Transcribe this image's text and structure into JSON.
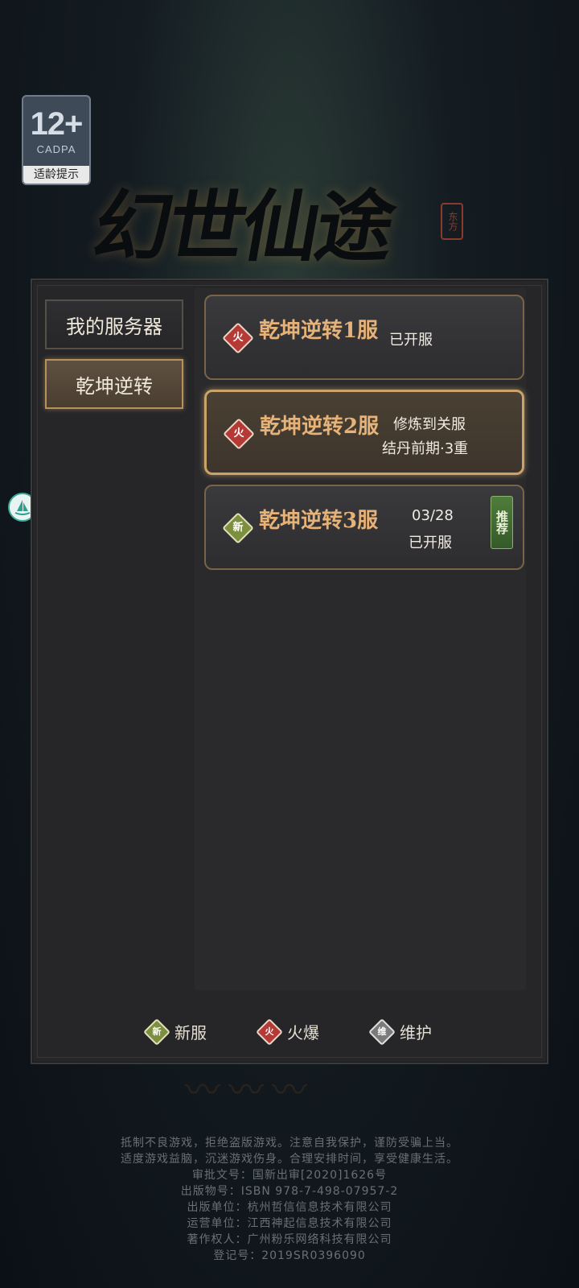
{
  "age_badge": {
    "age": "12+",
    "org": "CADPA",
    "tip": "适龄提示"
  },
  "logo": {
    "title": "幻世仙途",
    "seal": "东方"
  },
  "sidebar": {
    "tabs": [
      {
        "label": "我的服务器",
        "active": false
      },
      {
        "label": "乾坤逆转",
        "active": true
      }
    ]
  },
  "servers": [
    {
      "name": "乾坤逆转1服",
      "badge": "火",
      "badge_type": "hot",
      "status_line1": "已开服",
      "status_line2": "",
      "recommended": false,
      "selected": false
    },
    {
      "name": "乾坤逆转2服",
      "badge": "火",
      "badge_type": "hot",
      "status_line1": "修炼到关服",
      "status_line2": "结丹前期·3重",
      "recommended": false,
      "selected": true
    },
    {
      "name": "乾坤逆转3服",
      "badge": "新",
      "badge_type": "new",
      "status_line1": "03/28",
      "status_line2": "已开服",
      "recommended": true,
      "recommend_label": "推荐",
      "selected": false
    }
  ],
  "legend": [
    {
      "badge": "新",
      "label": "新服",
      "type": "new"
    },
    {
      "badge": "火",
      "label": "火爆",
      "type": "hot"
    },
    {
      "badge": "维",
      "label": "维护",
      "type": "maint"
    }
  ],
  "footer": {
    "lines": [
      "抵制不良游戏，拒绝盗版游戏。注意自我保护，谨防受骗上当。",
      "适度游戏益脑，沉迷游戏伤身。合理安排时间，享受健康生活。",
      "审批文号：国新出审[2020]1626号",
      "出版物号：ISBN 978-7-498-07957-2",
      "出版单位：杭州哲信信息技术有限公司",
      "运营单位：江西神起信息技术有限公司",
      "著作权人：广州粉乐网络科技有限公司",
      "登记号：2019SR0396090"
    ]
  },
  "colors": {
    "accent": "#e6b278",
    "hot": "#b53a36",
    "new": "#7b8f3f",
    "maint": "#7a7a7a"
  }
}
